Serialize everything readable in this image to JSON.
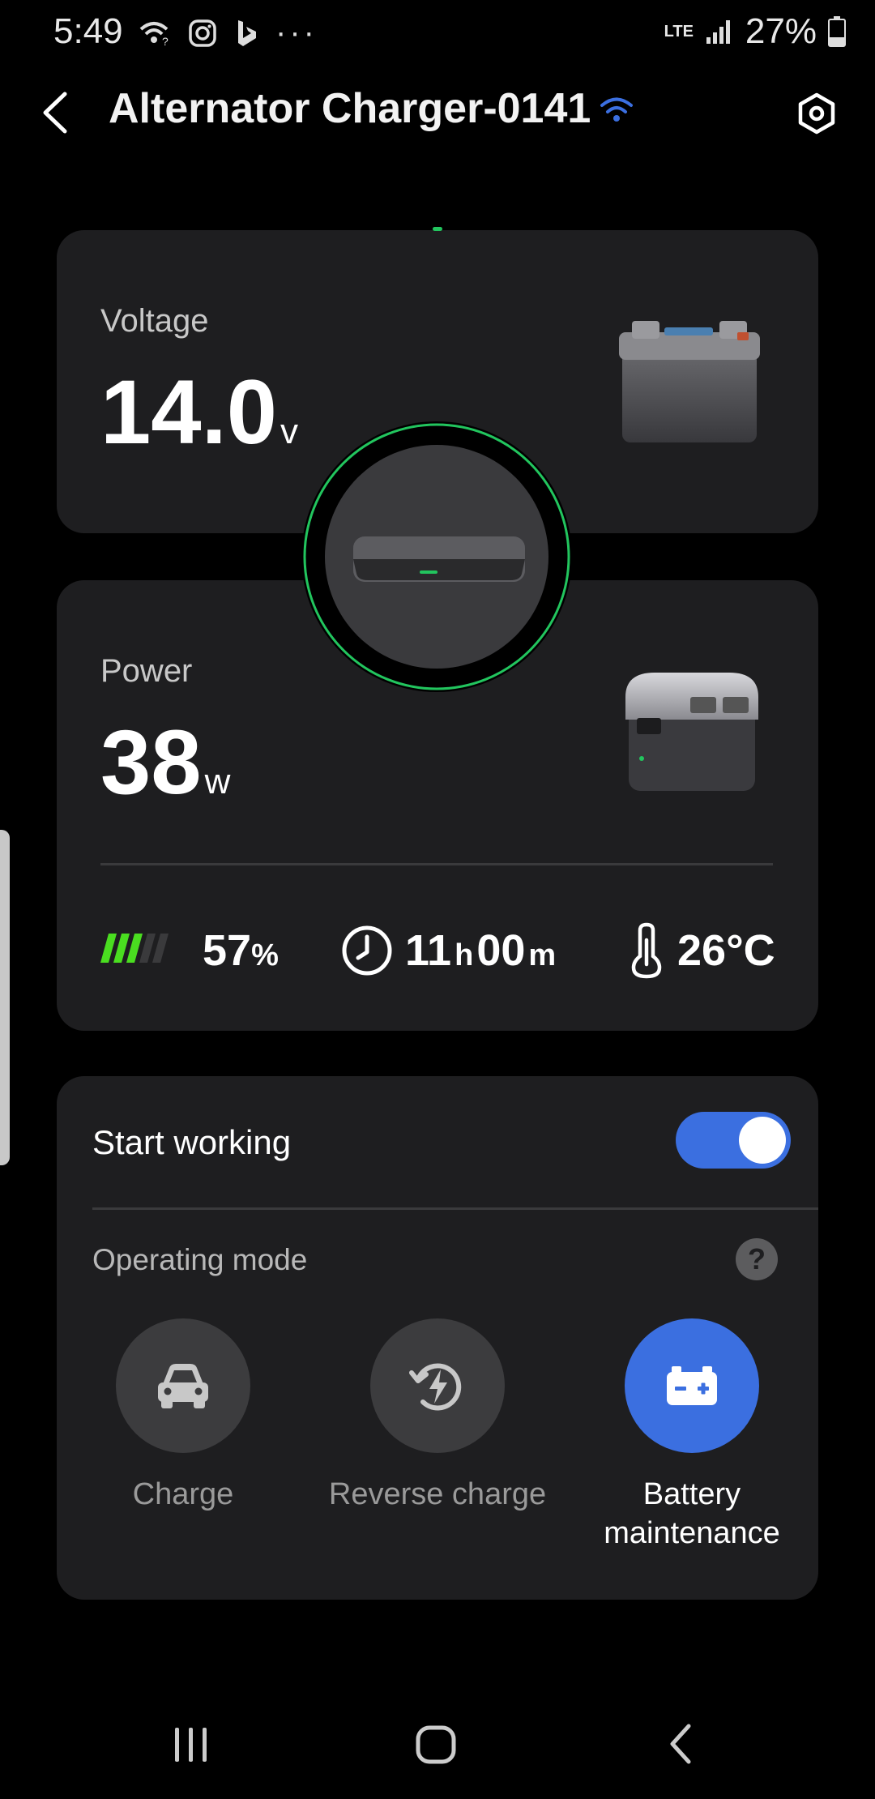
{
  "status_bar": {
    "time": "5:49",
    "dots": "···",
    "network": "LTE",
    "battery": "27%"
  },
  "header": {
    "title": "Alternator Charger-0141"
  },
  "voltage": {
    "label": "Voltage",
    "value": "14.0",
    "unit": "v"
  },
  "power": {
    "label": "Power",
    "value": "38",
    "unit": "w",
    "battery_percent": "57",
    "battery_percent_unit": "%",
    "battery_level": 0.57,
    "time_hours": "11",
    "time_h_unit": "h",
    "time_minutes": "00",
    "time_m_unit": "m",
    "temperature": "26°C"
  },
  "control": {
    "start_label": "Start working",
    "start_on": true,
    "mode_label": "Operating mode",
    "help": "?",
    "modes": [
      {
        "label": "Charge",
        "icon": "car-icon",
        "active": false
      },
      {
        "label": "Reverse charge",
        "icon": "reverse-charge-icon",
        "active": false
      },
      {
        "label": "Battery\nmaintenance",
        "label_line1": "Battery",
        "label_line2": "maintenance",
        "icon": "battery-icon",
        "active": true
      }
    ]
  },
  "colors": {
    "accent": "#3b6fe0",
    "ring": "#22c55e",
    "card": "#1e1e20"
  }
}
